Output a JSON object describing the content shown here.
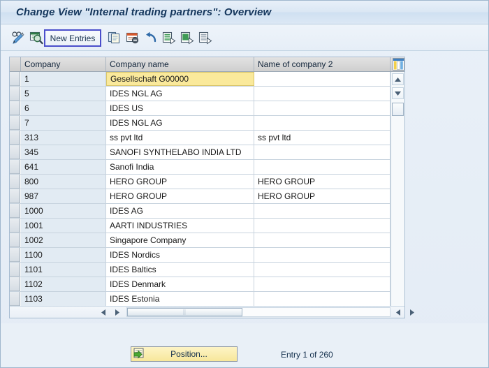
{
  "window": {
    "title": "Change View \"Internal trading partners\": Overview"
  },
  "toolbar": {
    "icons": [
      {
        "name": "display-change-icon",
        "title": "Display/Change"
      },
      {
        "name": "check-entries-icon",
        "title": "Check Entries"
      },
      {
        "name": "copy-as-icon",
        "title": "Copy As..."
      },
      {
        "name": "delete-icon",
        "title": "Delete"
      },
      {
        "name": "undo-icon",
        "title": "Undo Change"
      },
      {
        "name": "select-all-icon",
        "title": "Select All"
      },
      {
        "name": "select-block-icon",
        "title": "Select Block"
      },
      {
        "name": "deselect-all-icon",
        "title": "Deselect All"
      }
    ],
    "new_entries_label": "New Entries"
  },
  "table": {
    "columns": [
      {
        "key": "company",
        "label": "Company"
      },
      {
        "key": "company_name",
        "label": "Company name"
      },
      {
        "key": "name_of_company_2",
        "label": "Name of company 2"
      }
    ],
    "config_icon": "column-configuration-icon",
    "focused_cell": {
      "row": 0,
      "column": 1
    },
    "rows": [
      {
        "company": "1",
        "company_name": "Gesellschaft G00000",
        "name_of_company_2": ""
      },
      {
        "company": "5",
        "company_name": "IDES NGL AG",
        "name_of_company_2": ""
      },
      {
        "company": "6",
        "company_name": "IDES US",
        "name_of_company_2": ""
      },
      {
        "company": "7",
        "company_name": "IDES NGL AG",
        "name_of_company_2": ""
      },
      {
        "company": "313",
        "company_name": "ss pvt ltd",
        "name_of_company_2": "ss pvt ltd"
      },
      {
        "company": "345",
        "company_name": "SANOFI SYNTHELABO INDIA LTD",
        "name_of_company_2": ""
      },
      {
        "company": "641",
        "company_name": "Sanofi India",
        "name_of_company_2": ""
      },
      {
        "company": "800",
        "company_name": "HERO GROUP",
        "name_of_company_2": "HERO GROUP"
      },
      {
        "company": "987",
        "company_name": "HERO GROUP",
        "name_of_company_2": "HERO GROUP"
      },
      {
        "company": "1000",
        "company_name": "IDES AG",
        "name_of_company_2": ""
      },
      {
        "company": "1001",
        "company_name": "AARTI INDUSTRIES",
        "name_of_company_2": ""
      },
      {
        "company": "1002",
        "company_name": "Singapore Company",
        "name_of_company_2": ""
      },
      {
        "company": "1100",
        "company_name": "IDES Nordics",
        "name_of_company_2": ""
      },
      {
        "company": "1101",
        "company_name": "IDES Baltics",
        "name_of_company_2": ""
      },
      {
        "company": "1102",
        "company_name": "IDES Denmark",
        "name_of_company_2": ""
      },
      {
        "company": "1103",
        "company_name": "IDES Estonia",
        "name_of_company_2": ""
      }
    ]
  },
  "scrollbars": {
    "vertical": {
      "up_icon": "scroll-up-icon",
      "down_icon": "scroll-down-icon"
    },
    "horizontal": {
      "left_icon": "scroll-left-icon",
      "right_icon": "scroll-right-icon"
    }
  },
  "footer": {
    "position_button_label": "Position...",
    "position_button_icon": "position-icon",
    "entry_status": "Entry 1 of 260"
  },
  "colors": {
    "title_text": "#14365c",
    "focus_border": "#4a4ecb",
    "focused_cell_bg": "#fae99b",
    "focused_cell_marker": "#d03030",
    "position_button_bg": "#f7e79b",
    "key_column_bg": "#e2ebf3"
  }
}
